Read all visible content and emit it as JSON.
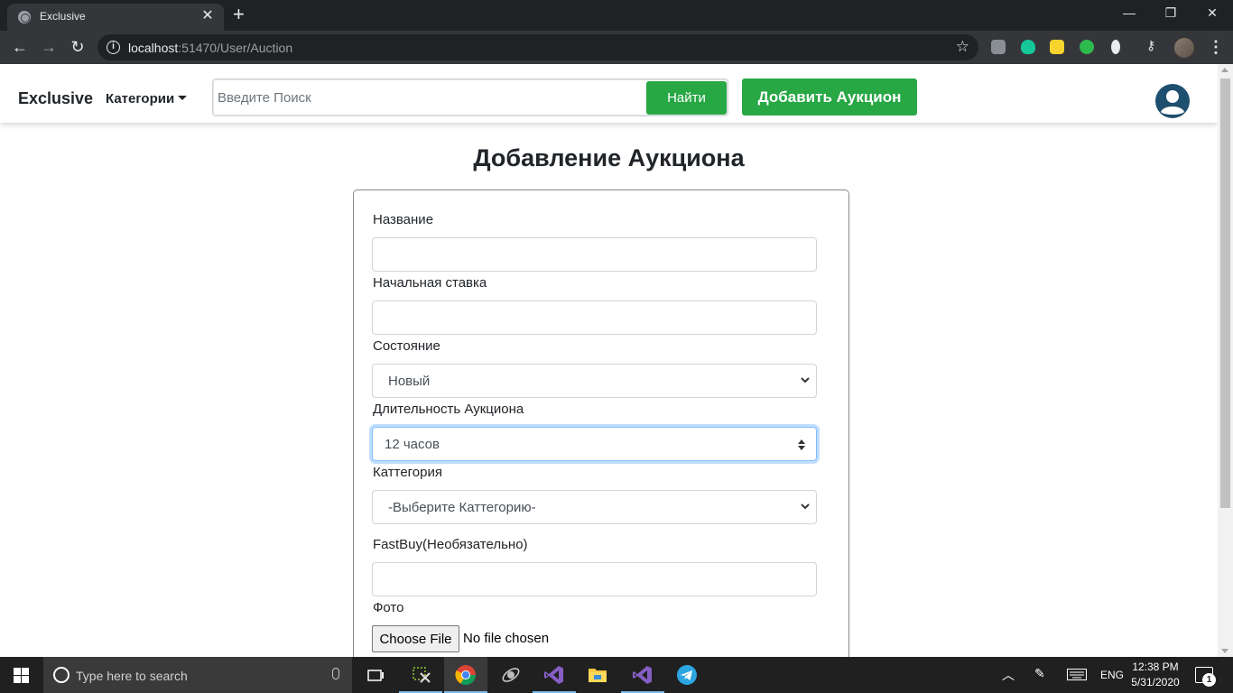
{
  "browser": {
    "tab_title": "Exclusive",
    "tab_close": "✕",
    "new_tab": "+",
    "url_host": "localhost",
    "url_rest": ":51470/User/Auction",
    "window_controls": [
      "—",
      "❐",
      "✕"
    ]
  },
  "navbar": {
    "brand": "Exclusive",
    "categories_label": "Категории",
    "search_placeholder": "Введите Поиск",
    "search_button": "Найти",
    "add_button": "Добавить Аукцион"
  },
  "page": {
    "title": "Добавление Аукциона"
  },
  "form": {
    "name_label": "Название",
    "name_value": "",
    "start_bid_label": "Начальная ставка",
    "start_bid_value": "",
    "condition_label": "Состояние",
    "condition_selected": "Новый",
    "duration_label": "Длительность Аукциона",
    "duration_selected": "12 часов",
    "category_label": "Каттегория",
    "category_selected": "-Выберите Каттегорию-",
    "fastbuy_label": "FastBuy(Необязательно)",
    "fastbuy_value": "",
    "photo_label": "Фото",
    "file_button": "Choose File",
    "file_status": "No file chosen"
  },
  "taskbar": {
    "search_placeholder": "Type here to search",
    "language": "ENG",
    "time": "12:38 PM",
    "date": "5/31/2020",
    "notification_count": "1"
  },
  "colors": {
    "accent_green": "#28a745",
    "user_icon": "#1f4f6e",
    "focus_blue": "#80bdff"
  }
}
